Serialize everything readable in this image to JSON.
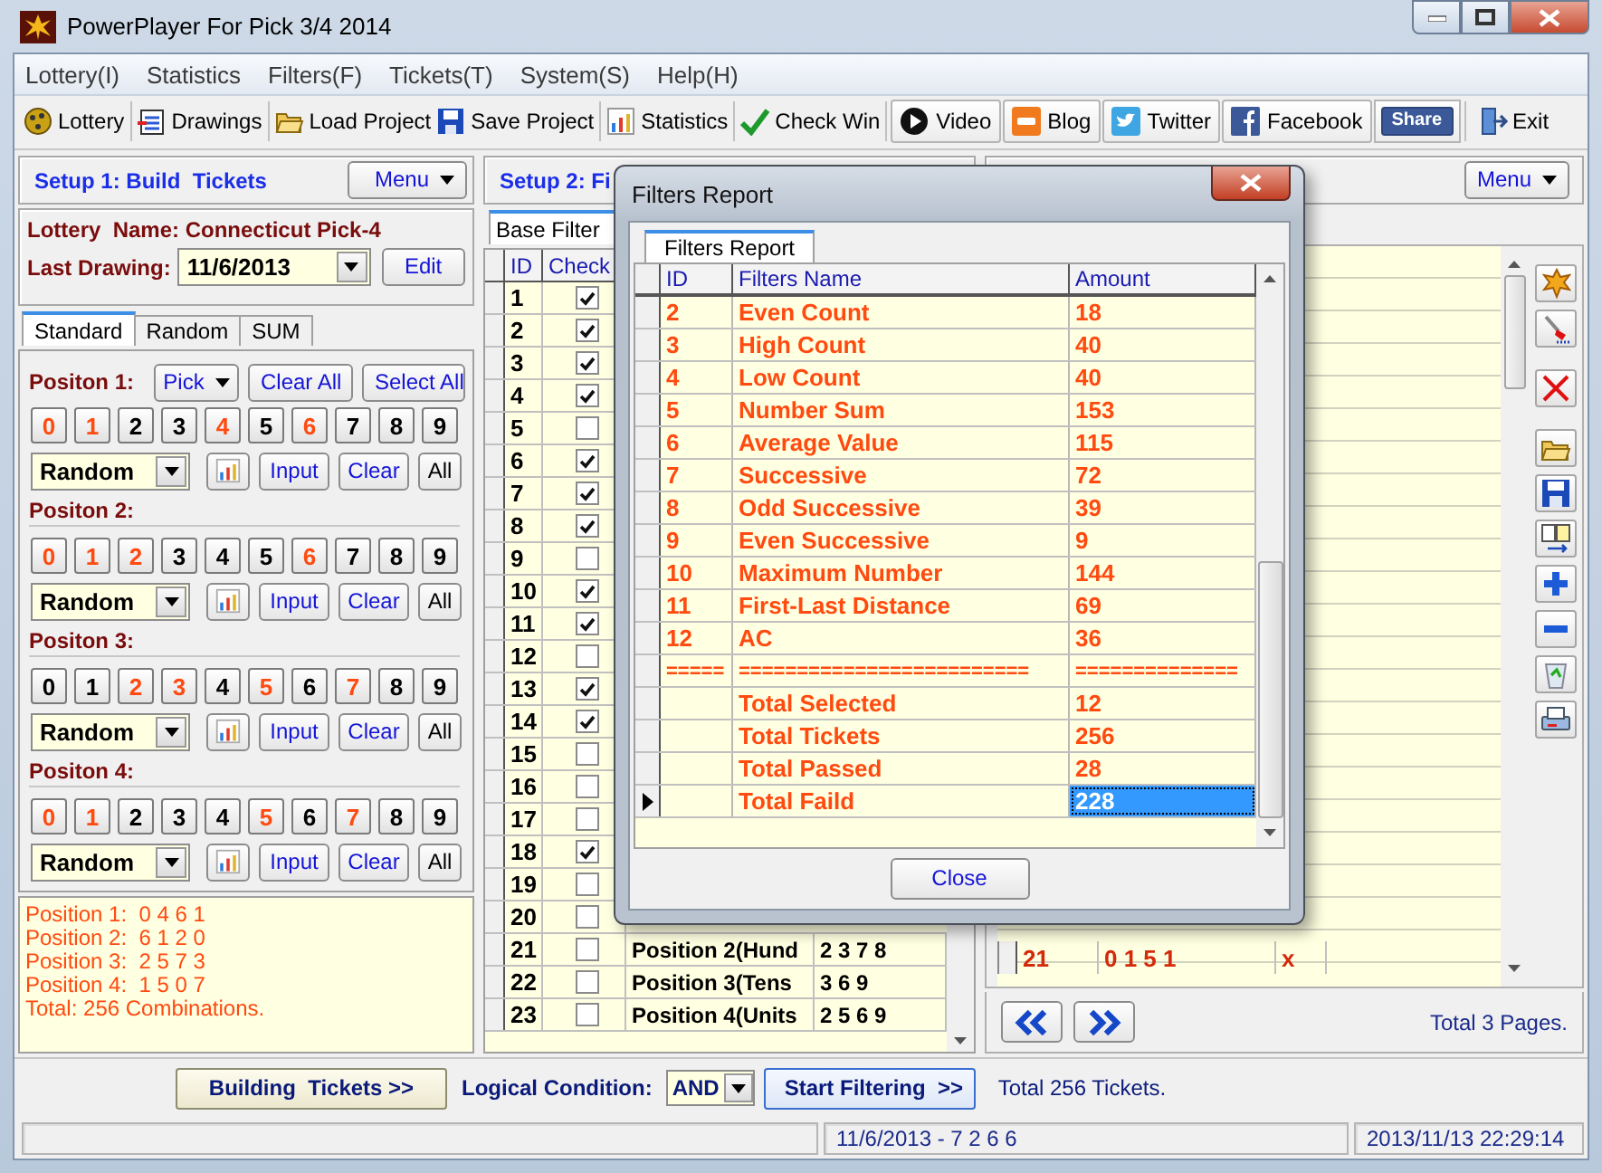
{
  "window": {
    "title": "PowerPlayer For Pick 3/4 2014"
  },
  "menu": [
    "Lottery(I)",
    "Statistics",
    "Filters(F)",
    "Tickets(T)",
    "System(S)",
    "Help(H)"
  ],
  "toolbar": {
    "groups": [
      [
        {
          "label": "Lottery",
          "kind": "tool"
        }
      ],
      [
        {
          "label": "Drawings",
          "kind": "tool"
        }
      ],
      [
        {
          "label": "Load Project",
          "kind": "tool"
        },
        {
          "label": "Save Project",
          "kind": "tool"
        }
      ],
      [
        {
          "label": "Statistics",
          "kind": "tool"
        }
      ],
      [
        {
          "label": "Check Win",
          "kind": "tool"
        }
      ],
      [
        {
          "label": "Video",
          "kind": "framed"
        },
        {
          "label": "Blog",
          "kind": "framed"
        },
        {
          "label": "Twitter",
          "kind": "framed"
        },
        {
          "label": "Facebook",
          "kind": "framed"
        },
        {
          "label": "Share",
          "kind": "badge"
        }
      ],
      [
        {
          "label": "Exit",
          "kind": "tool"
        }
      ]
    ]
  },
  "build_panel": {
    "header": "Setup 1: Build  Tickets",
    "menu_button": "Menu",
    "lottery": "Lottery  Name: Connecticut Pick-4",
    "last_drawing_label": "Last Drawing:",
    "last_drawing": "11/6/2013",
    "edit_button": "Edit",
    "tabs": [
      {
        "label": "Standard",
        "selected": true
      },
      {
        "label": "Random",
        "selected": false
      },
      {
        "label": "SUM",
        "selected": false
      }
    ],
    "pick_button": "Pick",
    "clear_all_button": "Clear All",
    "select_all_button": "Select All",
    "positions": [
      {
        "label": "Positon 1:",
        "mode": "Random",
        "input_button": "Input",
        "clear_button": "Clear",
        "all_button": "All",
        "digits": [
          {
            "label": "0",
            "selected": true
          },
          {
            "label": "1",
            "selected": true
          },
          {
            "label": "2",
            "selected": false
          },
          {
            "label": "3",
            "selected": false
          },
          {
            "label": "4",
            "selected": true
          },
          {
            "label": "5",
            "selected": false
          },
          {
            "label": "6",
            "selected": true
          },
          {
            "label": "7",
            "selected": false
          },
          {
            "label": "8",
            "selected": false
          },
          {
            "label": "9",
            "selected": false
          }
        ]
      },
      {
        "label": "Positon 2:",
        "mode": "Random",
        "input_button": "Input",
        "clear_button": "Clear",
        "all_button": "All",
        "digits": [
          {
            "label": "0",
            "selected": true
          },
          {
            "label": "1",
            "selected": true
          },
          {
            "label": "2",
            "selected": true
          },
          {
            "label": "3",
            "selected": false
          },
          {
            "label": "4",
            "selected": false
          },
          {
            "label": "5",
            "selected": false
          },
          {
            "label": "6",
            "selected": true
          },
          {
            "label": "7",
            "selected": false
          },
          {
            "label": "8",
            "selected": false
          },
          {
            "label": "9",
            "selected": false
          }
        ]
      },
      {
        "label": "Positon 3:",
        "mode": "Random",
        "input_button": "Input",
        "clear_button": "Clear",
        "all_button": "All",
        "digits": [
          {
            "label": "0",
            "selected": false
          },
          {
            "label": "1",
            "selected": false
          },
          {
            "label": "2",
            "selected": true
          },
          {
            "label": "3",
            "selected": true
          },
          {
            "label": "4",
            "selected": false
          },
          {
            "label": "5",
            "selected": true
          },
          {
            "label": "6",
            "selected": false
          },
          {
            "label": "7",
            "selected": true
          },
          {
            "label": "8",
            "selected": false
          },
          {
            "label": "9",
            "selected": false
          }
        ]
      },
      {
        "label": "Positon 4:",
        "mode": "Random",
        "input_button": "Input",
        "clear_button": "Clear",
        "all_button": "All",
        "digits": [
          {
            "label": "0",
            "selected": true
          },
          {
            "label": "1",
            "selected": true
          },
          {
            "label": "2",
            "selected": false
          },
          {
            "label": "3",
            "selected": false
          },
          {
            "label": "4",
            "selected": false
          },
          {
            "label": "5",
            "selected": true
          },
          {
            "label": "6",
            "selected": false
          },
          {
            "label": "7",
            "selected": true
          },
          {
            "label": "8",
            "selected": false
          },
          {
            "label": "9",
            "selected": false
          }
        ]
      }
    ],
    "summary": [
      "Position 1:  0 4 6 1",
      "Position 2:  6 1 2 0",
      "Position 3:  2 5 7 3",
      "Position 4:  1 5 0 7",
      "Total: 256 Combinations."
    ]
  },
  "filter_panel": {
    "header": "Setup 2: Fi",
    "tab": "Base Filter",
    "columns": [
      "ID",
      "Check"
    ],
    "rows": [
      {
        "number": "1",
        "checked": true
      },
      {
        "number": "2",
        "checked": true
      },
      {
        "number": "3",
        "checked": true
      },
      {
        "number": "4",
        "checked": true
      },
      {
        "number": "5",
        "checked": false
      },
      {
        "number": "6",
        "checked": true
      },
      {
        "number": "7",
        "checked": true
      },
      {
        "number": "8",
        "checked": true
      },
      {
        "number": "9",
        "checked": false
      },
      {
        "number": "10",
        "checked": true
      },
      {
        "number": "11",
        "checked": true
      },
      {
        "number": "12",
        "checked": false
      },
      {
        "number": "13",
        "checked": true
      },
      {
        "number": "14",
        "checked": true
      },
      {
        "number": "15",
        "checked": false
      },
      {
        "number": "16",
        "checked": false
      },
      {
        "number": "17",
        "checked": false
      },
      {
        "number": "18",
        "checked": true
      },
      {
        "number": "19",
        "checked": false
      },
      {
        "number": "20",
        "checked": false
      },
      {
        "number": "21",
        "checked": false,
        "name": "Position 2(Hund",
        "value": "2 3 7 8"
      },
      {
        "number": "22",
        "checked": false,
        "name": "Position 3(Tens",
        "value": "3 6 9"
      },
      {
        "number": "23",
        "checked": false,
        "name": "Position 4(Units",
        "value": "2 5 6 9"
      }
    ]
  },
  "ticket_panel": {
    "menu_button": "Menu",
    "rows": [
      {
        "number": "21",
        "numbers": "0 1 5 1",
        "mark": "x"
      }
    ],
    "pages": "Total 3 Pages."
  },
  "action_bar": {
    "build_button": "Building  Tickets >>",
    "logic_label": "Logical Condition:",
    "logic_value": "AND",
    "start_button": "Start Filtering  >>",
    "total": "Total 256 Tickets."
  },
  "status_bar": {
    "drawing": "11/6/2013 - 7 2 6 6",
    "time": "2013/11/13 22:29:14"
  },
  "report_dialog": {
    "title": "Filters Report",
    "tab": "Filters Report",
    "columns": [
      "ID",
      "Filters Name",
      "Amount"
    ],
    "rows": [
      {
        "kind": "data",
        "number": "2",
        "name": "Even Count",
        "amount": "18",
        "selected": false
      },
      {
        "kind": "data",
        "number": "3",
        "name": "High Count",
        "amount": "40",
        "selected": false
      },
      {
        "kind": "data",
        "number": "4",
        "name": "Low Count",
        "amount": "40",
        "selected": false
      },
      {
        "kind": "data",
        "number": "5",
        "name": "Number Sum",
        "amount": "153",
        "selected": false
      },
      {
        "kind": "data",
        "number": "6",
        "name": "Average Value",
        "amount": "115",
        "selected": false
      },
      {
        "kind": "data",
        "number": "7",
        "name": "Successive",
        "amount": "72",
        "selected": false
      },
      {
        "kind": "data",
        "number": "8",
        "name": "Odd Successive",
        "amount": "39",
        "selected": false
      },
      {
        "kind": "data",
        "number": "9",
        "name": "Even Successive",
        "amount": "9",
        "selected": false
      },
      {
        "kind": "data",
        "number": "10",
        "name": "Maximum Number",
        "amount": "144",
        "selected": false
      },
      {
        "kind": "data",
        "number": "11",
        "name": "First-Last Distance",
        "amount": "69",
        "selected": false
      },
      {
        "kind": "data",
        "number": "12",
        "name": "AC",
        "amount": "36",
        "selected": false
      },
      {
        "kind": "separator",
        "number": "=====",
        "name": "=========================",
        "amount": "=============="
      },
      {
        "kind": "total",
        "name": "Total Selected",
        "amount": "12",
        "selected": false
      },
      {
        "kind": "total",
        "name": "Total Tickets",
        "amount": "256",
        "selected": false
      },
      {
        "kind": "total",
        "name": "Total Passed",
        "amount": "28",
        "selected": false
      },
      {
        "kind": "total",
        "name": "Total Faild",
        "amount": "228",
        "selected": true
      }
    ],
    "close_button": "Close"
  }
}
